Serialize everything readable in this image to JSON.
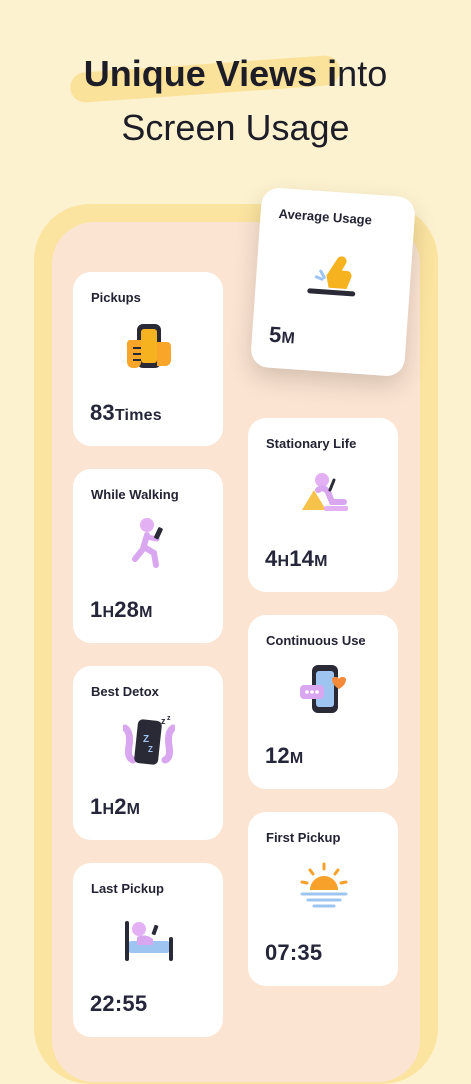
{
  "headline": {
    "line1_bold": "Unique Views i",
    "line1_regular": "nto",
    "line2": "Screen Usage"
  },
  "cards": {
    "average_usage": {
      "title": "Average Usage",
      "value_num": "5",
      "value_unit": "M"
    },
    "pickups": {
      "title": "Pickups",
      "value_num": "83",
      "value_unit": "Times"
    },
    "stationary_life": {
      "title": "Stationary Life",
      "v1": "4",
      "u1": "H",
      "v2": "14",
      "u2": "M"
    },
    "while_walking": {
      "title": "While Walking",
      "v1": "1",
      "u1": "H",
      "v2": "28",
      "u2": "M"
    },
    "continuous_use": {
      "title": "Continuous Use",
      "value_num": "12",
      "value_unit": "M"
    },
    "best_detox": {
      "title": "Best Detox",
      "v1": "1",
      "u1": "H",
      "v2": "2",
      "u2": "M"
    },
    "first_pickup": {
      "title": "First Pickup",
      "value": "07:35"
    },
    "last_pickup": {
      "title": "Last Pickup",
      "value": "22:55"
    }
  },
  "icons": {
    "average_usage": "hand-tapping-icon",
    "pickups": "hand-holding-phone-icon",
    "stationary_life": "person-sitting-with-phone-icon",
    "while_walking": "person-walking-with-phone-icon",
    "continuous_use": "phone-with-chat-and-heart-icon",
    "best_detox": "sleeping-phone-icon",
    "first_pickup": "sunrise-icon",
    "last_pickup": "person-in-bed-icon"
  },
  "colors": {
    "background": "#FDF2CF",
    "phone_frame": "#FBE3A0",
    "screen": "#FCE4D2",
    "card": "#FFFFFF",
    "accent_yellow": "#F7B21F",
    "accent_purple": "#D9A6F0",
    "accent_orange": "#F58A3A",
    "text": "#26263A"
  }
}
